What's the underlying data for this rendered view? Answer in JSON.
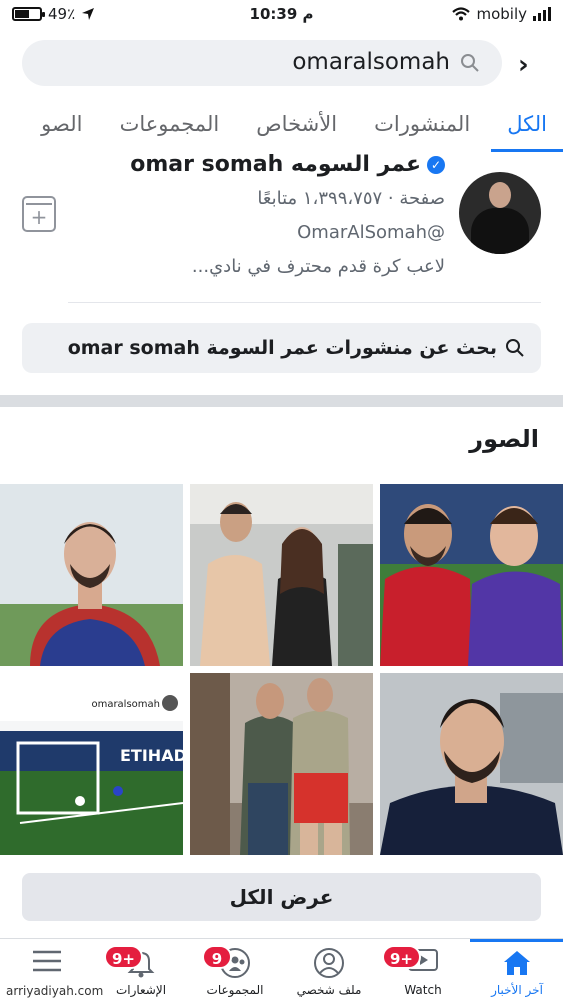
{
  "status_bar": {
    "battery": "49٪",
    "time": "10:39 م",
    "carrier": "mobily"
  },
  "search": {
    "query": "omaralsomah"
  },
  "tabs": [
    {
      "label": "الكل",
      "active": true
    },
    {
      "label": "المنشورات",
      "active": false
    },
    {
      "label": "الأشخاص",
      "active": false
    },
    {
      "label": "المجموعات",
      "active": false
    },
    {
      "label": "الصو",
      "active": false
    }
  ],
  "profile": {
    "name": "عمر السومه omar somah",
    "followers": "صفحة · ١،٣٩٩،٧٥٧ متابعًا",
    "handle": "@OmarAlSomah",
    "bio": "لاعب كرة قدم محترف في نادي..."
  },
  "post_search": {
    "label": "بحث عن منشورات عمر السومة omar somah"
  },
  "photos": {
    "title": "الصور",
    "post_handle": "omaralsomah",
    "ad_text": "ETIHAD"
  },
  "view_all": {
    "label": "عرض الكل"
  },
  "bottom_nav": {
    "items": [
      {
        "label": "آخر الأخبار",
        "icon": "home-icon",
        "active": true
      },
      {
        "label": "Watch",
        "icon": "watch-icon",
        "badge": "9+"
      },
      {
        "label": "ملف شخصي",
        "icon": "profile-icon"
      },
      {
        "label": "المجموعات",
        "icon": "groups-icon",
        "badge": "9"
      },
      {
        "label": "الإشعارات",
        "icon": "bell-icon",
        "badge": "9+"
      },
      {
        "label": "",
        "icon": "menu-icon"
      }
    ]
  },
  "watermark": "arriyadiyah.com",
  "colors": {
    "accent": "#1877f2",
    "badge": "#e41e3f",
    "input_bg": "#eef0f3"
  }
}
